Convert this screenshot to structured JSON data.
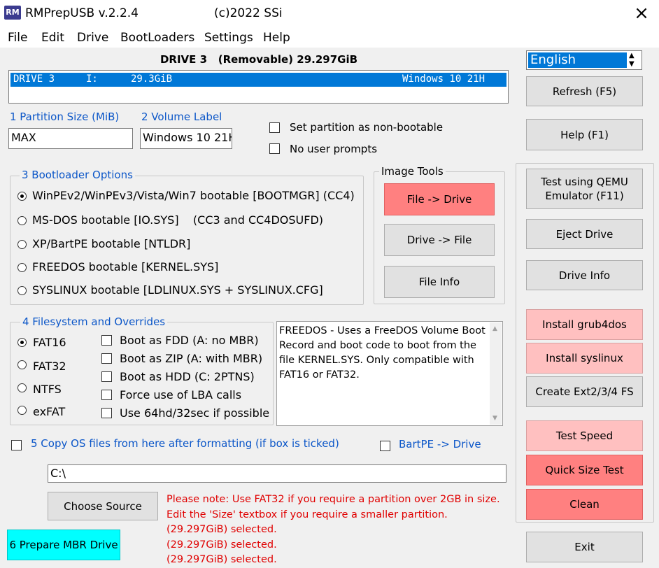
{
  "window": {
    "app_icon": "RM",
    "title": "RMPrepUSB v.2.2.4",
    "copyright": "(c)2022 SSi",
    "close_icon": "×"
  },
  "menu": [
    "File",
    "Edit",
    "Drive",
    "BootLoaders",
    "Settings",
    "Help"
  ],
  "drive": {
    "header": "DRIVE 3   (Removable) 29.297GiB",
    "list_row": {
      "name": "DRIVE 3",
      "letter": "I:",
      "size": "29.3GiB",
      "label": "Windows 10 21H"
    }
  },
  "language": {
    "selected": "English"
  },
  "partition": {
    "label": "1 Partition Size (MiB)",
    "value": "MAX"
  },
  "volume": {
    "label": "2 Volume Label",
    "value": "Windows 10 21H."
  },
  "options": {
    "non_bootable": "Set partition as non-bootable",
    "no_prompts": "No user prompts"
  },
  "bootloader": {
    "title": "3 Bootloader Options",
    "items": [
      "WinPEv2/WinPEv3/Vista/Win7 bootable [BOOTMGR] (CC4)",
      "MS-DOS bootable [IO.SYS]    (CC3 and CC4DOSUFD)",
      "XP/BartPE bootable [NTLDR]",
      "FREEDOS bootable [KERNEL.SYS]",
      "SYSLINUX bootable [LDLINUX.SYS + SYSLINUX.CFG]"
    ],
    "selected_index": 0
  },
  "image_tools": {
    "title": "Image Tools",
    "file_to_drive": "File -> Drive",
    "drive_to_file": "Drive -> File",
    "file_info": "File Info"
  },
  "filesystem": {
    "title": "4 Filesystem and Overrides",
    "types": [
      "FAT16",
      "FAT32",
      "NTFS",
      "exFAT"
    ],
    "selected_index": 0,
    "overrides": [
      "Boot as FDD (A: no MBR)",
      "Boot as ZIP (A: with MBR)",
      "Boot as HDD (C: 2PTNS)",
      "Force use of LBA calls",
      "Use 64hd/32sec if possible"
    ]
  },
  "info_text": "FREEDOS - Uses a FreeDOS Volume Boot Record and boot code to boot from the file KERNEL.SYS. Only compatible with FAT16 or FAT32.",
  "copy_files": {
    "label": "5 Copy OS files from here after formatting (if box is ticked)",
    "bartpe": "BartPE -> Drive",
    "path": "C:\\"
  },
  "buttons": {
    "refresh": "Refresh (F5)",
    "help": "Help (F1)",
    "qemu": "Test using QEMU Emulator (F11)",
    "eject": "Eject Drive",
    "drive_info": "Drive Info",
    "grub4dos": "Install grub4dos",
    "syslinux": "Install syslinux",
    "ext": "Create Ext2/3/4 FS",
    "test_speed": "Test Speed",
    "quick_size": "Quick Size Test",
    "clean": "Clean",
    "exit": "Exit",
    "choose_source": "Choose Source",
    "prepare": "6 Prepare MBR Drive"
  },
  "notes": [
    "Please note: Use FAT32 if you require a partition over 2GB in size.",
    "Edit the 'Size' textbox if you require a smaller partition.",
    "(29.297GiB) selected.",
    "(29.297GiB) selected.",
    "(29.297GiB) selected."
  ],
  "colors": {
    "accent_blue": "#0b56c8",
    "note_red": "#e00000",
    "pink": "#ffc0c0",
    "salmon": "#ff8080",
    "cyan": "#00ffff",
    "list_selection": "#0078d7"
  }
}
